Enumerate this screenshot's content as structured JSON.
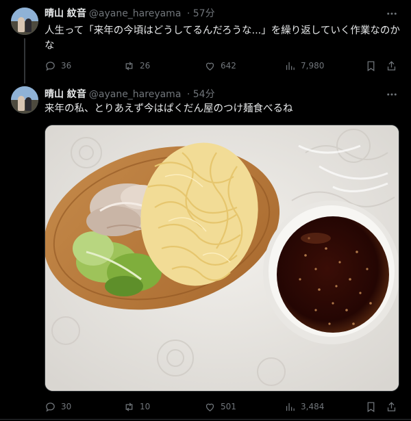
{
  "tweets": [
    {
      "name": "晴山 紋音",
      "handle": "@ayane_hareyama",
      "time": "· 57分",
      "text": "人生って「来年の今頃はどうしてるんだろうな...」を繰り返していく作業なのかな",
      "replies": "36",
      "retweets": "26",
      "likes": "642",
      "views": "7,980"
    },
    {
      "name": "晴山 紋音",
      "handle": "@ayane_hareyama",
      "time": "· 54分",
      "text": "来年の私、とりあえず今はぱくだん屋のつけ麺食べるね",
      "replies": "30",
      "retweets": "10",
      "likes": "501",
      "views": "3,484"
    }
  ],
  "colors": {
    "background": "#000000",
    "text": "#e7e9ea",
    "muted": "#71767b",
    "divider": "#2f3336"
  },
  "icons": [
    "more-icon",
    "reply-icon",
    "retweet-icon",
    "like-icon",
    "views-icon",
    "bookmark-icon",
    "share-icon"
  ]
}
